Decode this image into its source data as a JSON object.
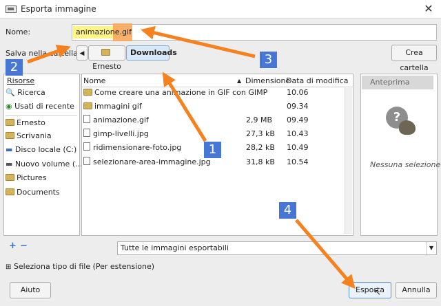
{
  "window": {
    "title": "Esporta immagine",
    "close_glyph": "✕",
    "app_icon": "image-export-icon"
  },
  "name_row": {
    "label": "Nome:",
    "value_base": "animazione",
    "value_ext": "gif"
  },
  "folder_row": {
    "label": "Salva nella cartella:",
    "prev_glyph": "◀",
    "crumbs": [
      "Ernesto",
      "Downloads"
    ],
    "create_folder": "Crea cartella"
  },
  "sidebar": {
    "header": "Risorse",
    "items": [
      {
        "label": "Ricerca",
        "icon": "search-icon"
      },
      {
        "label": "Usati di recente",
        "icon": "recent-icon"
      },
      {
        "label": "Ernesto",
        "icon": "folder-icon"
      },
      {
        "label": "Scrivania",
        "icon": "folder-icon"
      },
      {
        "label": "Disco locale (C:)",
        "icon": "drive-icon"
      },
      {
        "label": "Nuovo volume (...",
        "icon": "drive-icon"
      },
      {
        "label": "Pictures",
        "icon": "folder-icon"
      },
      {
        "label": "Documents",
        "icon": "folder-icon"
      }
    ],
    "add_glyph": "+",
    "remove_glyph": "−"
  },
  "file_list": {
    "columns": {
      "name": "Nome",
      "size": "Dimensione",
      "date": "Data di modifica"
    },
    "sort_glyph": "▲",
    "rows": [
      {
        "name": "Come creare una animazione in GIF con GIMP",
        "size": "",
        "date": "10.06",
        "type": "folder"
      },
      {
        "name": "immagini gif",
        "size": "",
        "date": "09.34",
        "type": "folder"
      },
      {
        "name": "animazione.gif",
        "size": "2,9 MB",
        "date": "09.49",
        "type": "file"
      },
      {
        "name": "gimp-livelli.jpg",
        "size": "27,3 kB",
        "date": "10.43",
        "type": "file"
      },
      {
        "name": "ridimensionare-foto.jpg",
        "size": "28,2 kB",
        "date": "10.49",
        "type": "file"
      },
      {
        "name": "selezionare-area-immagine.jpg",
        "size": "31,8 kB",
        "date": "10.54",
        "type": "file"
      }
    ]
  },
  "preview": {
    "header": "Anteprima",
    "empty": "Nessuna selezione",
    "icon": "help-icon"
  },
  "filter": {
    "selected": "Tutte le immagini esportabili",
    "arrow": "▼"
  },
  "file_type": {
    "label": "Seleziona tipo di file (Per estensione)",
    "expander": "⊞"
  },
  "buttons": {
    "help": "Aiuto",
    "export": "Esporta",
    "cancel": "Annulla"
  },
  "annotations": [
    "1",
    "2",
    "3",
    "4"
  ],
  "colors": {
    "arrow": "#f5821f",
    "badge": "#4876d4",
    "highlight": "#fff48a",
    "ext_highlight": "#f7a85a"
  }
}
